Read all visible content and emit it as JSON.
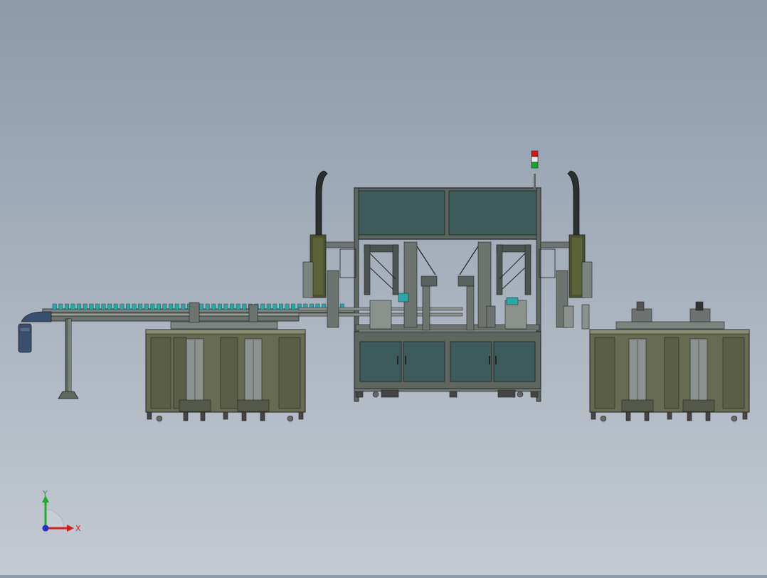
{
  "viewport": {
    "background_top": "#8d9aaa",
    "background_bottom": "#c3cad2"
  },
  "model": {
    "frame_color": "#5e6660",
    "panel_color": "#3d5b5b",
    "cabinet_color": "#676b52",
    "edge_color": "#222222",
    "bottle_color": "#2aa7a7",
    "motor_color": "#3a4f6e"
  },
  "stack_light": {
    "colors": [
      "#d01a1a",
      "#e8e8e8",
      "#1aa82a"
    ]
  },
  "triad": {
    "x_label": "X",
    "y_label": "Y",
    "x_color": "#d02020",
    "y_color": "#1faa30",
    "z_color": "#2030c0"
  }
}
